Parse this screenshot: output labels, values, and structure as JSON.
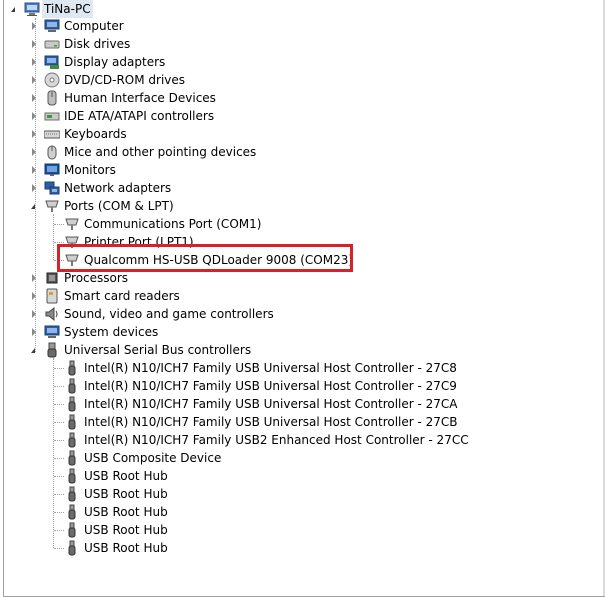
{
  "root": {
    "label": "TiNa-PC",
    "icon": "computer-icon"
  },
  "categories": [
    {
      "label": "Computer",
      "icon": "computer-icon"
    },
    {
      "label": "Disk drives",
      "icon": "disk-drive-icon"
    },
    {
      "label": "Display adapters",
      "icon": "display-adapter-icon"
    },
    {
      "label": "DVD/CD-ROM drives",
      "icon": "dvd-drive-icon"
    },
    {
      "label": "Human Interface Devices",
      "icon": "hid-icon"
    },
    {
      "label": "IDE ATA/ATAPI controllers",
      "icon": "ide-controller-icon"
    },
    {
      "label": "Keyboards",
      "icon": "keyboard-icon"
    },
    {
      "label": "Mice and other pointing devices",
      "icon": "mouse-icon"
    },
    {
      "label": "Monitors",
      "icon": "monitor-icon"
    },
    {
      "label": "Network adapters",
      "icon": "network-adapter-icon"
    },
    {
      "label": "Ports (COM & LPT)",
      "icon": "port-icon"
    },
    {
      "label": "Processors",
      "icon": "processor-icon"
    },
    {
      "label": "Smart card readers",
      "icon": "smart-card-icon"
    },
    {
      "label": "Sound, video and game controllers",
      "icon": "sound-icon"
    },
    {
      "label": "System devices",
      "icon": "system-device-icon"
    },
    {
      "label": "Universal Serial Bus controllers",
      "icon": "usb-icon"
    }
  ],
  "ports": [
    {
      "label": "Communications Port (COM1)",
      "icon": "port-icon"
    },
    {
      "label": "Printer Port (LPT1)",
      "icon": "port-icon"
    },
    {
      "label": "Qualcomm HS-USB QDLoader 9008 (COM23)",
      "icon": "port-icon"
    }
  ],
  "usb": [
    {
      "label": "Intel(R) N10/ICH7 Family USB Universal Host Controller - 27C8",
      "icon": "usb-icon"
    },
    {
      "label": "Intel(R) N10/ICH7 Family USB Universal Host Controller - 27C9",
      "icon": "usb-icon"
    },
    {
      "label": "Intel(R) N10/ICH7 Family USB Universal Host Controller - 27CA",
      "icon": "usb-icon"
    },
    {
      "label": "Intel(R) N10/ICH7 Family USB Universal Host Controller - 27CB",
      "icon": "usb-icon"
    },
    {
      "label": "Intel(R) N10/ICH7 Family USB2 Enhanced Host Controller - 27CC",
      "icon": "usb-icon"
    },
    {
      "label": "USB Composite Device",
      "icon": "usb-icon"
    },
    {
      "label": "USB Root Hub",
      "icon": "usb-icon"
    },
    {
      "label": "USB Root Hub",
      "icon": "usb-icon"
    },
    {
      "label": "USB Root Hub",
      "icon": "usb-icon"
    },
    {
      "label": "USB Root Hub",
      "icon": "usb-icon"
    },
    {
      "label": "USB Root Hub",
      "icon": "usb-icon"
    }
  ],
  "colors": {
    "highlight_border": "#d6222a",
    "selection": "#dfe7f1",
    "tree_lines": "#a0a0a0"
  }
}
